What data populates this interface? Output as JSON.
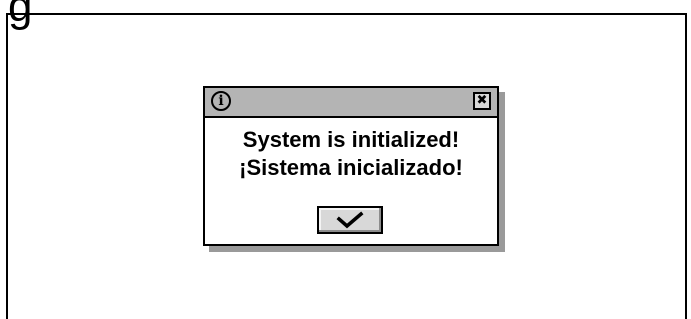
{
  "screen": {
    "heading_fragment": "g"
  },
  "dialog": {
    "icon": "info-icon",
    "icon_glyph": "i",
    "close_icon": "close-icon",
    "close_glyph": "✖",
    "message_line1": "System is initialized!",
    "message_line2": "¡Sistema inicializado!",
    "ok_icon": "checkmark-icon"
  },
  "colors": {
    "titlebar": "#b4b4b4",
    "button": "#d8d8d8",
    "shadow": "#9a9a9a",
    "text": "#000000",
    "background": "#ffffff"
  }
}
